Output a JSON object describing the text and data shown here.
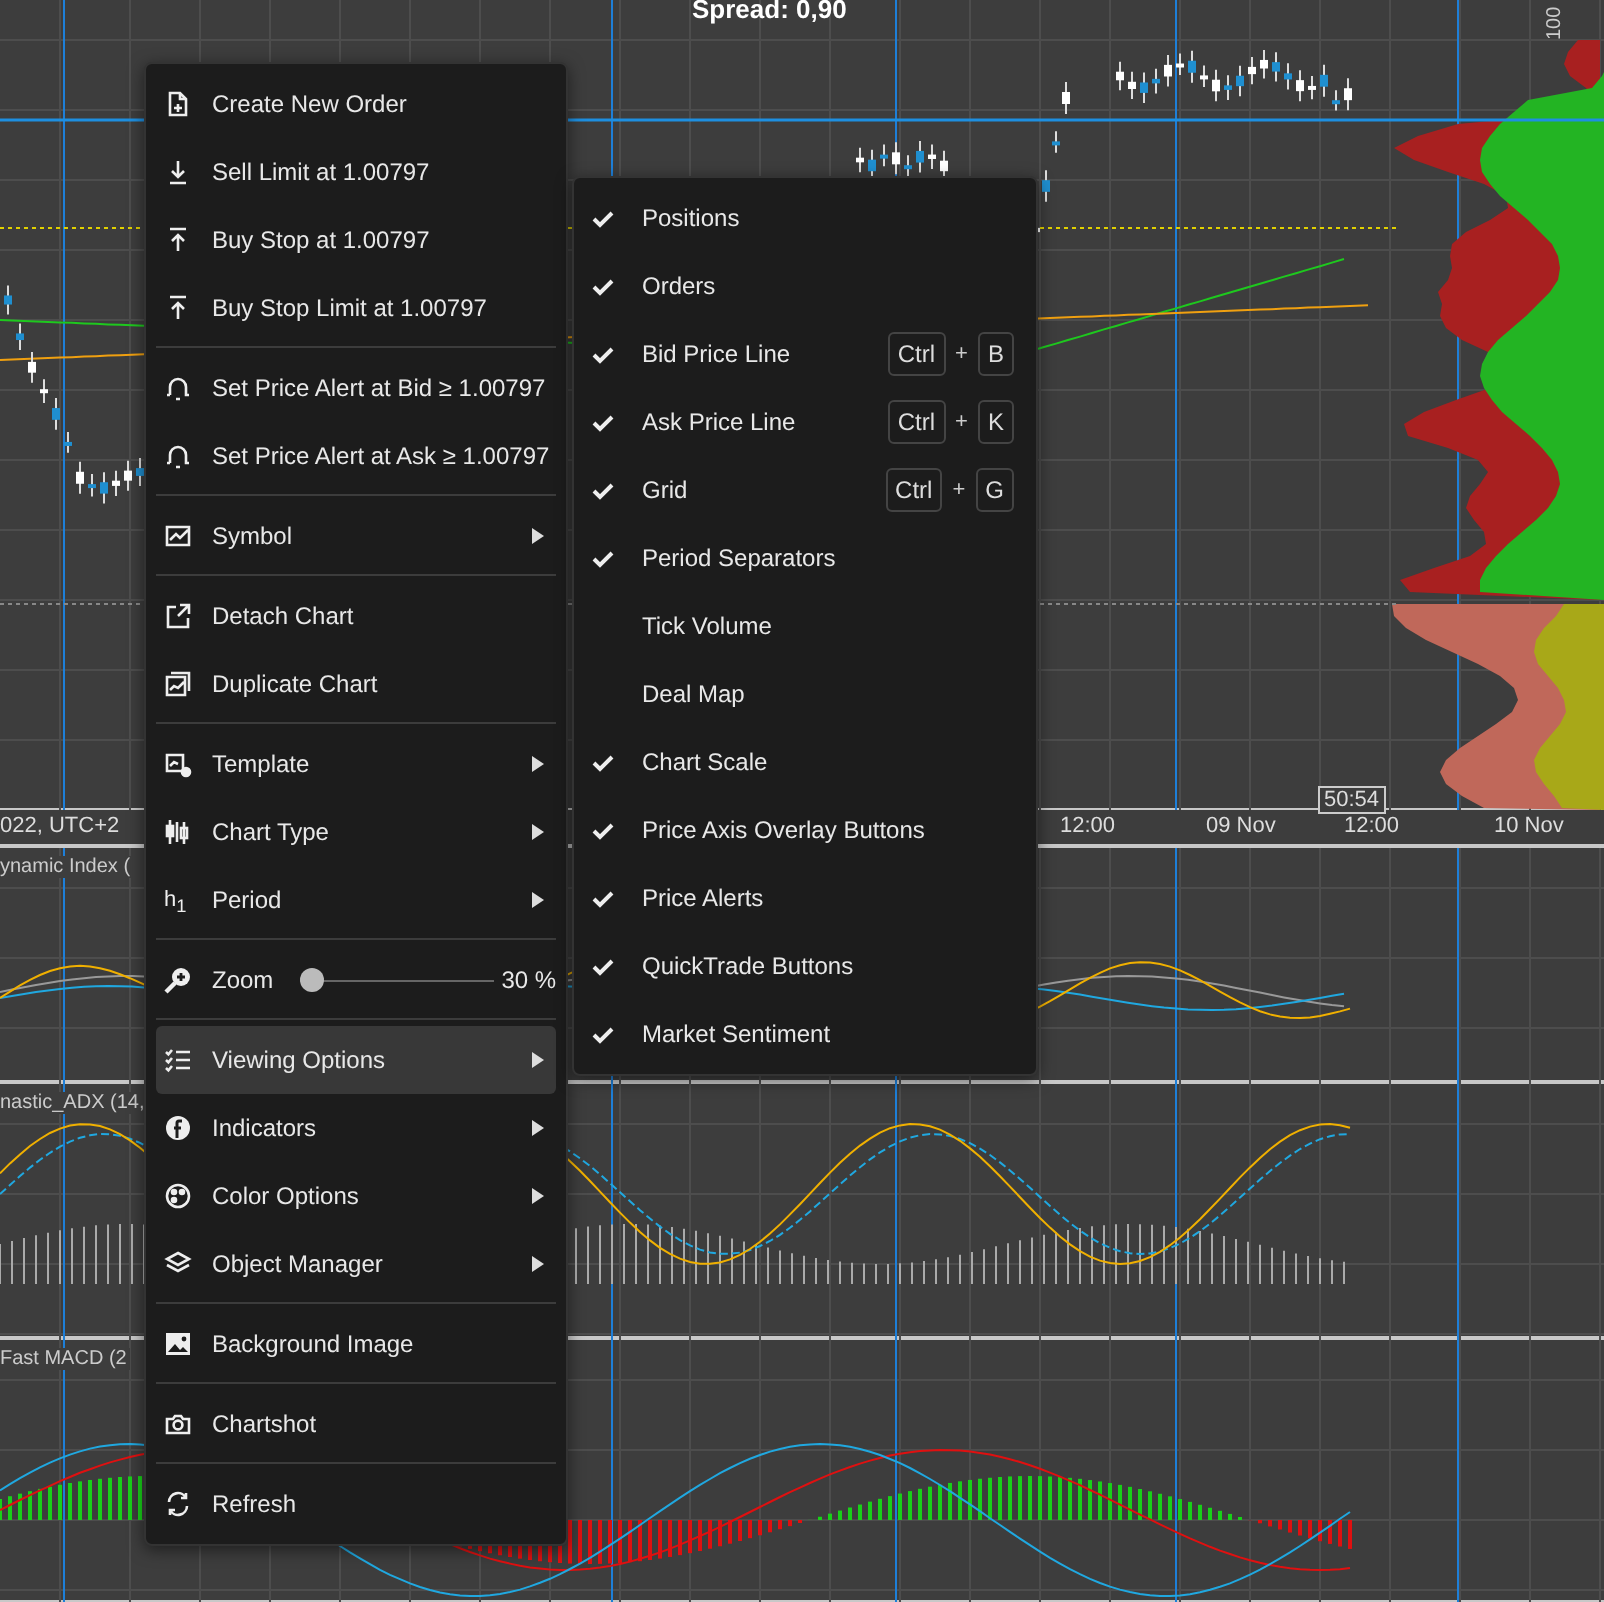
{
  "chart": {
    "spread": "Spread: 0,90",
    "price_scale_label": "100",
    "time_badge": "50:54",
    "time_axis": [
      "022, UTC+2",
      "12:00",
      "09 Nov",
      "12:00",
      "10 Nov"
    ],
    "indicator_panes": [
      {
        "title": "ynamic Index ("
      },
      {
        "title": "nastic_ADX (14,"
      },
      {
        "title": "Fast MACD (2"
      }
    ]
  },
  "context_menu": {
    "items": [
      {
        "kind": "item",
        "label": "Create New Order",
        "submenu": false,
        "selected": false
      },
      {
        "kind": "item",
        "label": "Sell Limit at 1.00797",
        "submenu": false,
        "selected": false
      },
      {
        "kind": "item",
        "label": "Buy Stop at 1.00797",
        "submenu": false,
        "selected": false
      },
      {
        "kind": "item",
        "label": "Buy Stop Limit at 1.00797",
        "submenu": false,
        "selected": false
      },
      {
        "kind": "separator"
      },
      {
        "kind": "item",
        "label": "Set Price Alert at Bid ≥ 1.00797",
        "submenu": false,
        "selected": false
      },
      {
        "kind": "item",
        "label": "Set Price Alert at Ask ≥ 1.00797",
        "submenu": false,
        "selected": false
      },
      {
        "kind": "separator"
      },
      {
        "kind": "item",
        "label": "Symbol",
        "submenu": true,
        "selected": false
      },
      {
        "kind": "separator"
      },
      {
        "kind": "item",
        "label": "Detach Chart",
        "submenu": false,
        "selected": false
      },
      {
        "kind": "item",
        "label": "Duplicate Chart",
        "submenu": false,
        "selected": false
      },
      {
        "kind": "separator"
      },
      {
        "kind": "item",
        "label": "Template",
        "submenu": true,
        "selected": false
      },
      {
        "kind": "item",
        "label": "Chart Type",
        "submenu": true,
        "selected": false
      },
      {
        "kind": "item",
        "label": "Period",
        "icon_text": "h$_{1}$",
        "submenu": true,
        "selected": false
      },
      {
        "kind": "separator"
      },
      {
        "kind": "slider",
        "label": "Zoom",
        "level": 0,
        "value": "30 %"
      },
      {
        "kind": "separator"
      },
      {
        "kind": "item",
        "label": "Viewing Options",
        "submenu": true,
        "selected": true
      },
      {
        "kind": "item",
        "label": "Indicators",
        "submenu": true,
        "selected": false
      },
      {
        "kind": "item",
        "label": "Color Options",
        "submenu": true,
        "selected": false
      },
      {
        "kind": "item",
        "label": "Object Manager",
        "submenu": true,
        "selected": false
      },
      {
        "kind": "separator"
      },
      {
        "kind": "item",
        "label": "Background Image",
        "submenu": false,
        "selected": false
      },
      {
        "kind": "separator"
      },
      {
        "kind": "item",
        "label": "Chartshot",
        "submenu": false,
        "selected": false
      },
      {
        "kind": "separator"
      },
      {
        "kind": "item",
        "label": "Refresh",
        "submenu": false,
        "selected": false
      }
    ]
  },
  "viewing_options": {
    "items": [
      {
        "label": "Positions",
        "checked": true
      },
      {
        "label": "Orders",
        "checked": true
      },
      {
        "label": "Bid Price Line",
        "checked": true,
        "shortcut": [
          {
            "kind": "key",
            "text": "Ctrl"
          },
          {
            "kind": "joiner",
            "text": "+"
          },
          {
            "kind": "key",
            "text": "B"
          }
        ]
      },
      {
        "label": "Ask Price Line",
        "checked": true,
        "shortcut": [
          {
            "kind": "key",
            "text": "Ctrl"
          },
          {
            "kind": "joiner",
            "text": "+"
          },
          {
            "kind": "key",
            "text": "K"
          }
        ]
      },
      {
        "label": "Grid",
        "checked": true,
        "shortcut": [
          {
            "kind": "key",
            "text": "Ctrl"
          },
          {
            "kind": "joiner",
            "text": "+"
          },
          {
            "kind": "key",
            "text": "G"
          }
        ]
      },
      {
        "label": "Period Separators",
        "checked": true
      },
      {
        "label": "Tick Volume",
        "checked": false
      },
      {
        "label": "Deal Map",
        "checked": false
      },
      {
        "label": "Chart Scale",
        "checked": true
      },
      {
        "label": "Price Axis Overlay Buttons",
        "checked": true
      },
      {
        "label": "Price Alerts",
        "checked": true
      },
      {
        "label": "QuickTrade Buttons",
        "checked": true
      },
      {
        "label": "Market Sentiment",
        "checked": true
      }
    ]
  }
}
